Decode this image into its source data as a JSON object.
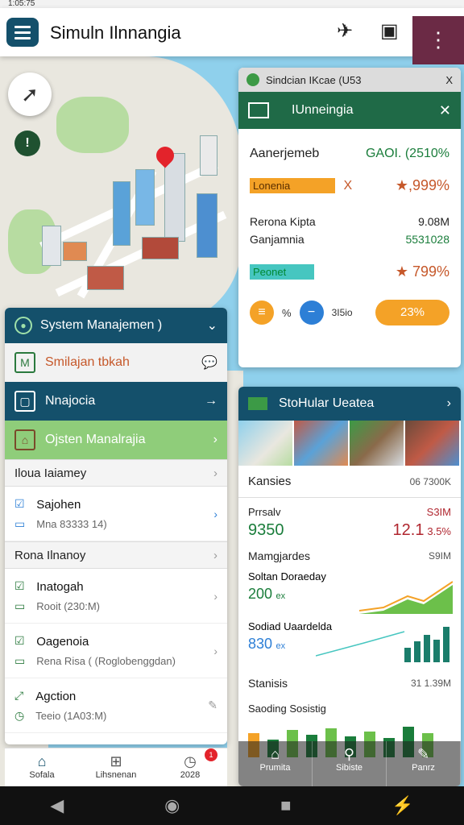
{
  "status": {
    "time": "1:05:75"
  },
  "appbar": {
    "title": "Simuln Ilnnangia",
    "icons": [
      "menu-icon",
      "pin-icon",
      "calendar-icon",
      "more-icon"
    ]
  },
  "left_panel": {
    "header": "System Manajemen )",
    "rows": [
      {
        "label": "Smilajan tbkah"
      },
      {
        "label": "Nnajocia"
      },
      {
        "label": "Ojsten Manalrajia"
      }
    ],
    "section1": "Iloua Iaiamey",
    "item1": {
      "title": "Sajohen",
      "sub": "Mna 83333 14)"
    },
    "section2": "Rona Ilnanoy",
    "items": [
      {
        "title": "Inatogah",
        "sub": "Rooit (230:M)"
      },
      {
        "title": "Oagenoia",
        "sub": "Rena Risa ( (Roglobenggdan)"
      },
      {
        "title": "Agction",
        "sub": "Teeio (1A03:M)"
      }
    ]
  },
  "bottom_nav": [
    {
      "label": "Sofala",
      "icon": "home-icon"
    },
    {
      "label": "Lihsnenan",
      "icon": "building-icon"
    },
    {
      "label": "2028",
      "icon": "clock-icon",
      "badge": "1"
    }
  ],
  "right_top": {
    "tab": "Sindcian IKcae (U53",
    "tab_extra": "X",
    "header": "IUnneingia",
    "row1": {
      "label": "Aanerjemeb",
      "value": "GAOI. (2510%"
    },
    "row2": {
      "chip": "Lonenia",
      "chip_mark": "X",
      "value": "★,999%"
    },
    "row3": {
      "label": "Rerona Kipta",
      "value": "9.08M"
    },
    "row4": {
      "label": "Ganjamnia",
      "value": "5531028"
    },
    "row5": {
      "chip": "Peonet",
      "value": "★ 799%"
    },
    "controls": {
      "a": "%",
      "b": "3I5io",
      "pill": "23%"
    }
  },
  "right_bottom": {
    "header": "StoHular Ueatea",
    "kansies": {
      "label": "Kansies",
      "value": "06 7300K"
    },
    "prsalv": {
      "label": "Prrsalv",
      "value": "S3IM"
    },
    "big": {
      "left": "9350",
      "right": "12.1",
      "right_suffix": "3.5%"
    },
    "mamgjardes": {
      "label": "Mamgjardes",
      "value": "S9IM"
    },
    "soltan": {
      "label": "Soltan Doraeday",
      "value": "200",
      "suffix": "ex"
    },
    "sodiad": {
      "label": "Sodiad Uaardelda",
      "value": "830",
      "suffix": "ex"
    },
    "stanisis": {
      "label": "Stanisis",
      "value": "31 1.39M"
    },
    "saoding": {
      "label": "Saoding Sosistig"
    },
    "buttons": [
      {
        "label": "Prumita",
        "icon": "home-icon"
      },
      {
        "label": "Sibiste",
        "icon": "bike-icon"
      },
      {
        "label": "Panrz",
        "icon": "edit-icon"
      }
    ]
  },
  "system_nav": [
    "back-icon",
    "home-icon",
    "recents-icon",
    "bolt-icon"
  ],
  "colors": {
    "navy": "#14506b",
    "green": "#1f6a47",
    "orange": "#f4a227",
    "accent_red": "#e3232b"
  }
}
